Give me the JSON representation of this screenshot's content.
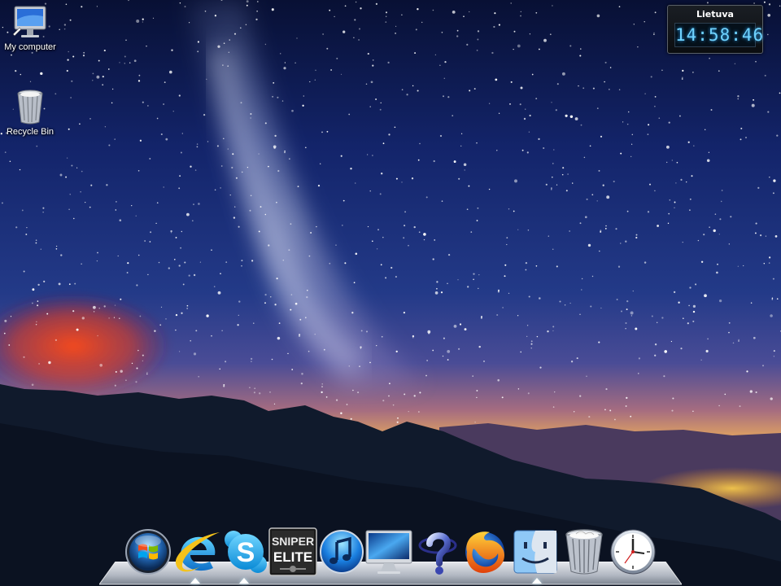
{
  "desktop": {
    "icons": [
      {
        "label": "My computer",
        "icon": "monitor-icon"
      },
      {
        "label": "Recycle Bin",
        "icon": "recycle-bin-icon"
      }
    ]
  },
  "clock_widget": {
    "city": "Lietuva",
    "time": "14:58:46",
    "accent_color": "#6fd3ff"
  },
  "dock": {
    "items": [
      {
        "name": "Start",
        "icon": "windows-orb-icon",
        "running": false
      },
      {
        "name": "Internet Explorer",
        "icon": "internet-explorer-icon",
        "running": true
      },
      {
        "name": "Skype",
        "icon": "skype-icon",
        "running": true
      },
      {
        "name": "Sniper Elite",
        "icon": "sniper-elite-icon",
        "running": false,
        "text_line1": "SNIPER",
        "text_line2": "ELITE"
      },
      {
        "name": "iTunes",
        "icon": "itunes-icon",
        "running": false
      },
      {
        "name": "iMac",
        "icon": "imac-icon",
        "running": false
      },
      {
        "name": "Help",
        "icon": "help-icon",
        "running": false
      },
      {
        "name": "Firefox",
        "icon": "firefox-icon",
        "running": false
      },
      {
        "name": "Finder",
        "icon": "finder-icon",
        "running": true
      },
      {
        "name": "Trash",
        "icon": "trash-icon",
        "running": false
      },
      {
        "name": "Clock",
        "icon": "clock-icon",
        "running": false
      }
    ]
  }
}
